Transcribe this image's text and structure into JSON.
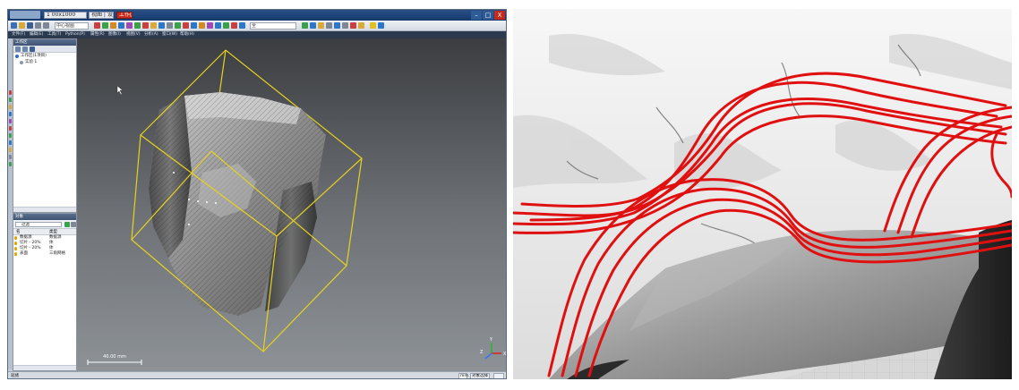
{
  "window": {
    "title_value": "1 00x1000",
    "title_suffix": "视图 | 设置",
    "title_pill": "工作区"
  },
  "window_controls": {
    "minimize": "–",
    "maximize": "□",
    "close": "X"
  },
  "toolbar": {
    "combo_a_value": "中心视图",
    "combo_b_value": "全"
  },
  "menu": [
    "文件(F)",
    "编辑(E)",
    "工具(T)",
    "Python(P)",
    "属性(R)",
    "图像(I)",
    "视图(V)",
    "分析(A)",
    "窗口(W)",
    "帮助(H)"
  ],
  "project_panel": {
    "header": "工作区",
    "tree": [
      {
        "label": "工作区(1项目)"
      },
      {
        "label": "实验 1"
      }
    ]
  },
  "objects_panel": {
    "header": "对象",
    "filter_value": "过滤",
    "columns": [
      "名",
      "类型"
    ],
    "rows": [
      {
        "name": "数据源",
        "type": "数据源",
        "color": "#e0a800"
      },
      {
        "name": "切片 - 20%",
        "type": "体",
        "color": "#e0a800"
      },
      {
        "name": "切片 - 20%",
        "type": "体",
        "color": "#e0a800"
      },
      {
        "name": "表面",
        "type": "三角网格",
        "color": "#e0a800"
      }
    ]
  },
  "viewport": {
    "scale_label": "40.00 mm",
    "axis_labels": {
      "x": "X",
      "y": "Y",
      "z": "Z"
    },
    "bbox_color": "#e6d21e",
    "stream_color": "#e01010"
  },
  "status": {
    "left": "就绪",
    "unit": "mm",
    "mode": "对象选择"
  }
}
